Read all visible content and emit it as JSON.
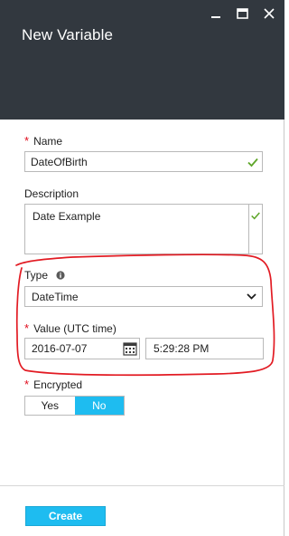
{
  "blade": {
    "title": "New Variable",
    "window_controls": [
      "minimize-icon",
      "maximize-icon",
      "close-icon"
    ]
  },
  "name": {
    "label": "Name",
    "required": "*",
    "value": "DateOfBirth"
  },
  "description": {
    "label": "Description",
    "value": "Date Example"
  },
  "type": {
    "label": "Type",
    "selected": "DateTime"
  },
  "value": {
    "label": "Value (UTC time)",
    "required": "*",
    "date": "2016-07-07",
    "time": "5:29:28 PM"
  },
  "encrypted": {
    "label": "Encrypted",
    "required": "*",
    "options": [
      "Yes",
      "No"
    ],
    "selected": "No"
  },
  "footer": {
    "create_label": "Create"
  },
  "colors": {
    "header_bg": "#32383f",
    "accent": "#1ebcf0",
    "required": "#e00b1c",
    "valid_check": "#5fa62a",
    "annotation": "#e21b23"
  }
}
